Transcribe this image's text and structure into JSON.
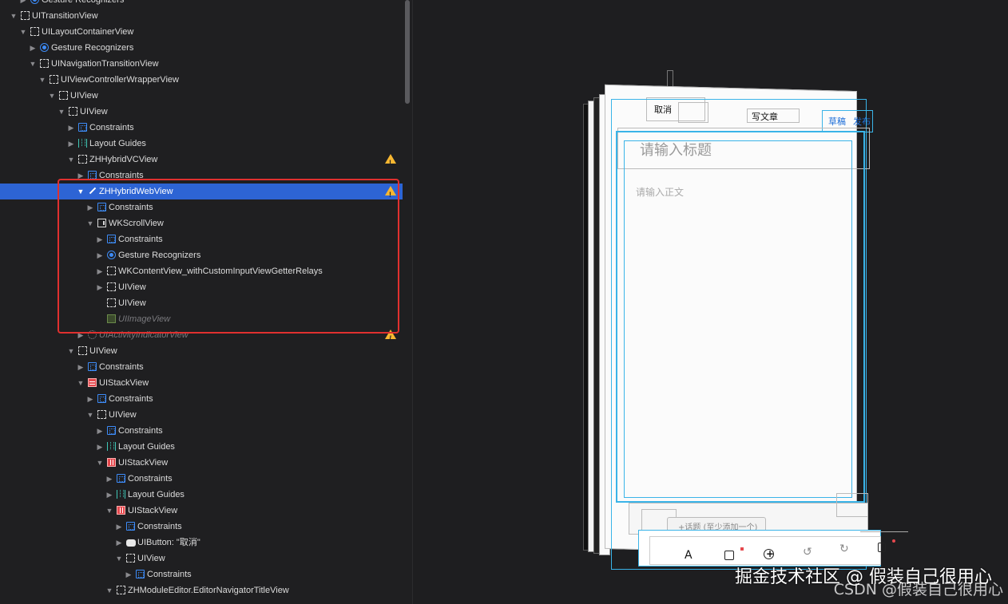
{
  "navigator": {
    "rows": [
      {
        "label": "Gesture Recognizers",
        "icon": "gesture",
        "indent": 1,
        "triangle": "right"
      },
      {
        "label": "UITransitionView",
        "icon": "view",
        "indent": 0,
        "triangle": "down"
      },
      {
        "label": "UILayoutContainerView",
        "icon": "view",
        "indent": 1,
        "triangle": "down"
      },
      {
        "label": "Gesture Recognizers",
        "icon": "gesture",
        "indent": 2,
        "triangle": "right"
      },
      {
        "label": "UINavigationTransitionView",
        "icon": "view",
        "indent": 2,
        "triangle": "down"
      },
      {
        "label": "UIViewControllerWrapperView",
        "icon": "view",
        "indent": 3,
        "triangle": "down"
      },
      {
        "label": "UIView",
        "icon": "view",
        "indent": 4,
        "triangle": "down"
      },
      {
        "label": "UIView",
        "icon": "view",
        "indent": 5,
        "triangle": "down"
      },
      {
        "label": "Constraints",
        "icon": "constraints",
        "indent": 6,
        "triangle": "right"
      },
      {
        "label": "Layout Guides",
        "icon": "guides",
        "indent": 6,
        "triangle": "right"
      },
      {
        "label": "ZHHybridVCView",
        "icon": "view",
        "indent": 6,
        "triangle": "down",
        "warning": true
      },
      {
        "label": "Constraints",
        "icon": "constraints",
        "indent": 7,
        "triangle": "right"
      },
      {
        "label": "ZHHybridWebView",
        "icon": "pen",
        "indent": 7,
        "triangle": "down",
        "warning": true,
        "selected": true
      },
      {
        "label": "Constraints",
        "icon": "constraints",
        "indent": 8,
        "triangle": "right"
      },
      {
        "label": "WKScrollView",
        "icon": "scroll",
        "indent": 8,
        "triangle": "down"
      },
      {
        "label": "Constraints",
        "icon": "constraints",
        "indent": 9,
        "triangle": "right"
      },
      {
        "label": "Gesture Recognizers",
        "icon": "gesture",
        "indent": 9,
        "triangle": "right"
      },
      {
        "label": "WKContentView_withCustomInputViewGetterRelays",
        "icon": "view",
        "indent": 9,
        "triangle": "right"
      },
      {
        "label": "UIView",
        "icon": "view",
        "indent": 9,
        "triangle": "right"
      },
      {
        "label": "UIView",
        "icon": "view",
        "indent": 9,
        "triangle": ""
      },
      {
        "label": "UIImageView",
        "icon": "image",
        "indent": 9,
        "triangle": "",
        "dim": true
      },
      {
        "label": "UIActivityIndicatorView",
        "icon": "activity",
        "indent": 7,
        "triangle": "right",
        "dim": true,
        "warning": true
      },
      {
        "label": "UIView",
        "icon": "view",
        "indent": 6,
        "triangle": "down"
      },
      {
        "label": "Constraints",
        "icon": "constraints",
        "indent": 7,
        "triangle": "right"
      },
      {
        "label": "UIStackView",
        "icon": "stack",
        "indent": 7,
        "triangle": "down"
      },
      {
        "label": "Constraints",
        "icon": "constraints",
        "indent": 8,
        "triangle": "right"
      },
      {
        "label": "UIView",
        "icon": "view",
        "indent": 8,
        "triangle": "down"
      },
      {
        "label": "Constraints",
        "icon": "constraints",
        "indent": 9,
        "triangle": "right"
      },
      {
        "label": "Layout Guides",
        "icon": "guides",
        "indent": 9,
        "triangle": "right"
      },
      {
        "label": "UIStackView",
        "icon": "hstack",
        "indent": 9,
        "triangle": "down"
      },
      {
        "label": "Constraints",
        "icon": "constraints",
        "indent": 10,
        "triangle": "right"
      },
      {
        "label": "Layout Guides",
        "icon": "guides",
        "indent": 10,
        "triangle": "right"
      },
      {
        "label": "UIStackView",
        "icon": "hstack",
        "indent": 10,
        "triangle": "down"
      },
      {
        "label": "Constraints",
        "icon": "constraints",
        "indent": 11,
        "triangle": "right"
      },
      {
        "label": "UIButton: \"取消\"",
        "icon": "button",
        "indent": 11,
        "triangle": "right"
      },
      {
        "label": "UIView",
        "icon": "view",
        "indent": 11,
        "triangle": "down"
      },
      {
        "label": "Constraints",
        "icon": "constraints",
        "indent": 12,
        "triangle": "right"
      },
      {
        "label": "ZHModuleEditor.EditorNavigatorTitleView",
        "icon": "view",
        "indent": 10,
        "triangle": "down"
      }
    ]
  },
  "preview": {
    "cancel": "取消",
    "title": "写文章",
    "draft": "草稿",
    "publish": "发布",
    "title_placeholder": "请输入标题",
    "body_placeholder": "请输入正文",
    "topic": "+话题 (至少添加一个)"
  },
  "watermark": {
    "main": "掘金技术社区 @ 假装自己很用心",
    "sub": "CSDN @假装自己很用心"
  },
  "colors": {
    "selection": "#2d64d4",
    "warning": "#f7b731",
    "highlight": "#e0302f",
    "wireframe": "#3ab4e8"
  }
}
